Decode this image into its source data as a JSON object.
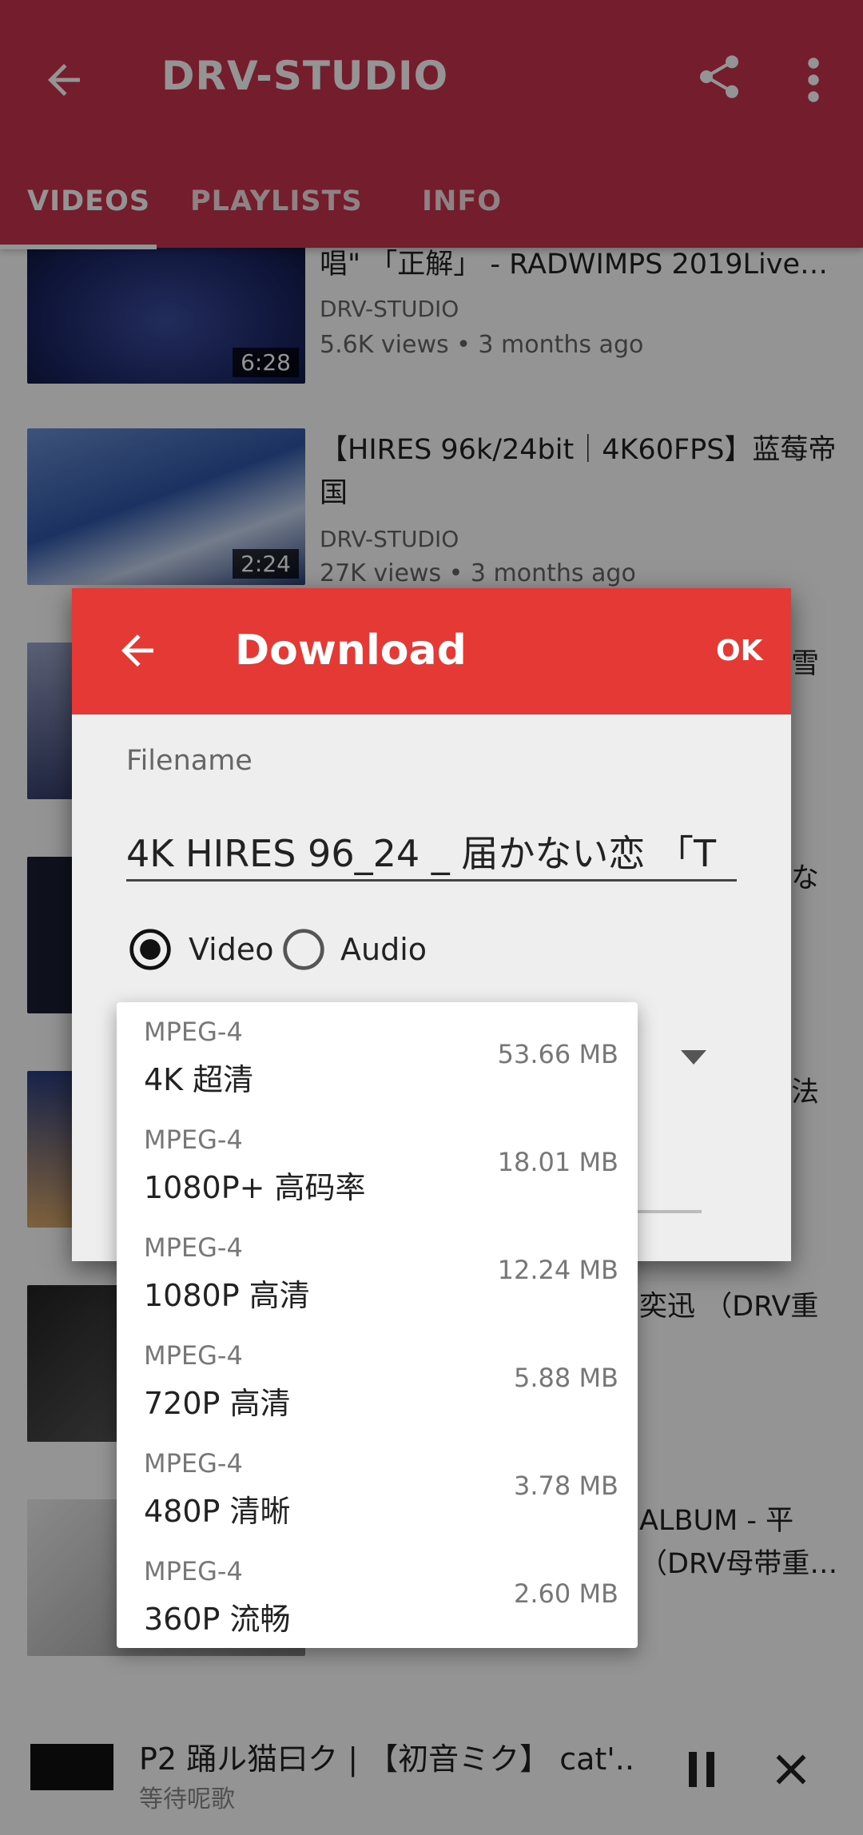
{
  "appbar": {
    "title": "DRV-STUDIO",
    "tabs": [
      "VIDEOS",
      "PLAYLISTS",
      "INFO"
    ],
    "color": "#c7324f"
  },
  "videos": [
    {
      "title": "唱\" 「正解」 - RADWIMPS 2019Live…",
      "channel": "DRV-STUDIO",
      "meta": "5.6K views • 3 months ago",
      "duration": "6:28"
    },
    {
      "title": "【HIRES 96k/24bit｜4K60FPS】蓝莓帝国",
      "channel": "DRV-STUDIO",
      "meta": "27K views • 3 months ago",
      "duration": "2:24"
    },
    {
      "title": "雪",
      "channel": "",
      "meta": "",
      "duration": ""
    },
    {
      "title": "な",
      "channel": "",
      "meta": "",
      "duration": ""
    },
    {
      "title": "法",
      "channel": "",
      "meta": "",
      "duration": ""
    },
    {
      "title": "奕迅 （DRV重",
      "channel": "",
      "meta": "",
      "duration": ""
    },
    {
      "title": "ALBUM - 平 （DRV母带重…",
      "channel": "",
      "meta": "",
      "duration": ""
    }
  ],
  "dialog": {
    "title": "Download",
    "ok": "OK",
    "filename_label": "Filename",
    "filename_value": "4K HIRES 96_24 _ 届かない恋 「T",
    "radio_video": "Video",
    "radio_audio": "Audio",
    "selected": "Video",
    "header_color": "#e53935"
  },
  "formats": [
    {
      "type": "MPEG-4",
      "label": "4K 超清",
      "size": "53.66 MB"
    },
    {
      "type": "MPEG-4",
      "label": "1080P+ 高码率",
      "size": "18.01 MB"
    },
    {
      "type": "MPEG-4",
      "label": "1080P 高清",
      "size": "12.24 MB"
    },
    {
      "type": "MPEG-4",
      "label": "720P 高清",
      "size": "5.88 MB"
    },
    {
      "type": "MPEG-4",
      "label": "480P 清晰",
      "size": "3.78 MB"
    },
    {
      "type": "MPEG-4",
      "label": "360P 流畅",
      "size": "2.60 MB"
    }
  ],
  "mini_player": {
    "title": "P2 踊ル猫曰ク | 【初音ミク】 cat'..",
    "subtitle": "等待呢歌"
  },
  "icons": {
    "back": "arrow-left-icon",
    "share": "share-icon",
    "more": "more-vert-icon",
    "dropdown": "chevron-down-icon",
    "pause": "pause-icon",
    "close": "close-icon"
  }
}
